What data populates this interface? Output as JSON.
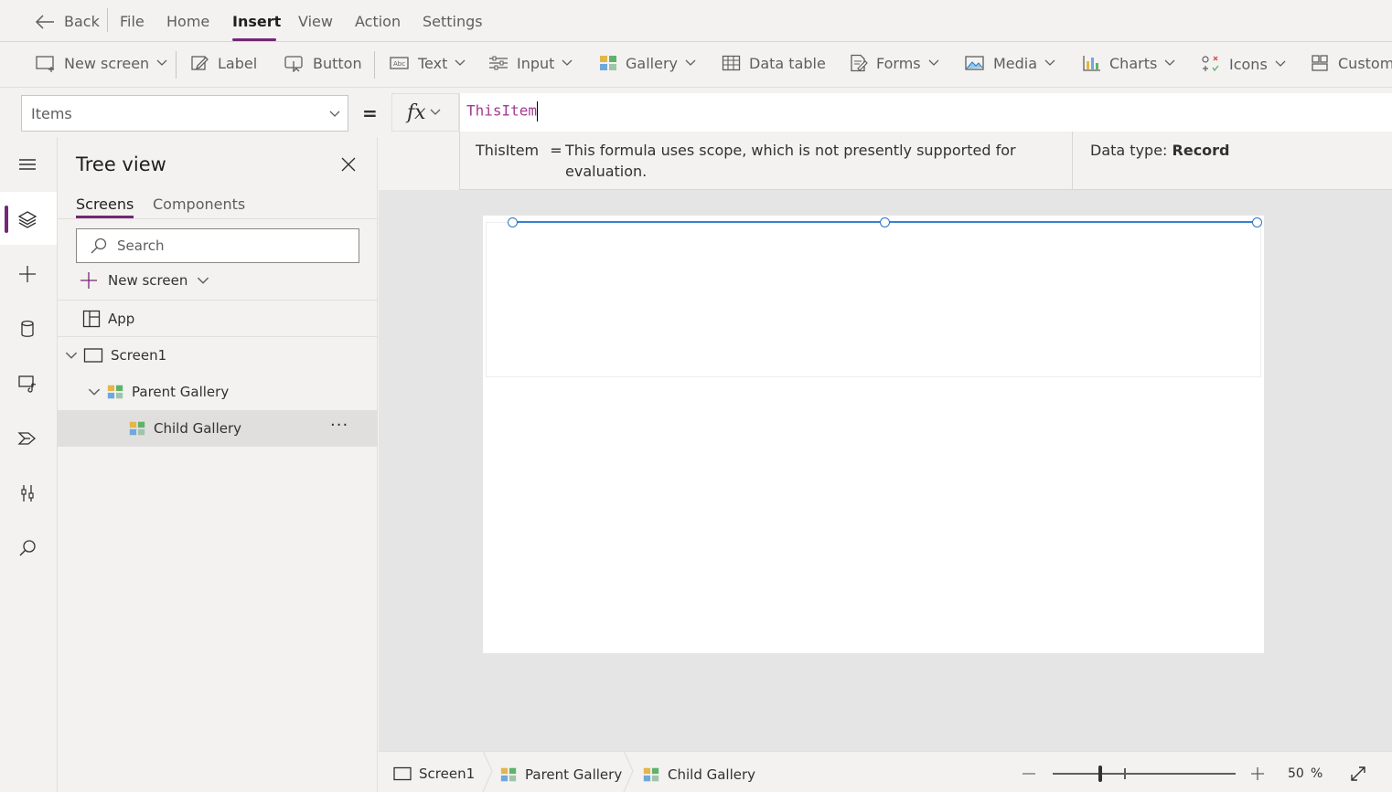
{
  "menubar": {
    "back_label": "Back",
    "items": [
      "File",
      "Home",
      "Insert",
      "View",
      "Action",
      "Settings"
    ],
    "active_item": "Insert"
  },
  "toolbar": {
    "new_screen": "New screen",
    "label": "Label",
    "button": "Button",
    "text": "Text",
    "input": "Input",
    "gallery": "Gallery",
    "data_table": "Data table",
    "forms": "Forms",
    "media": "Media",
    "charts": "Charts",
    "icons": "Icons",
    "custom": "Custom"
  },
  "formula": {
    "property": "Items",
    "equals": "=",
    "fx": "fx",
    "value": "ThisItem"
  },
  "intellisense": {
    "term": "ThisItem",
    "equals": "=",
    "message": "This formula uses scope, which is not presently supported for evaluation.",
    "datatype_label": "Data type:",
    "datatype_value": "Record"
  },
  "tree": {
    "title": "Tree view",
    "tabs": [
      "Screens",
      "Components"
    ],
    "search_placeholder": "Search",
    "new_screen": "New screen",
    "nodes": {
      "app": "App",
      "screen1": "Screen1",
      "parent_gallery": "Parent Gallery",
      "child_gallery": "Child Gallery",
      "more": "···"
    }
  },
  "statusbar": {
    "crumbs": [
      "Screen1",
      "Parent Gallery",
      "Child Gallery"
    ],
    "zoom_value": "50",
    "zoom_unit": "%"
  },
  "colors": {
    "accent": "#742774",
    "formula_text": "#a33c8f",
    "selection": "#3a7fd0"
  }
}
